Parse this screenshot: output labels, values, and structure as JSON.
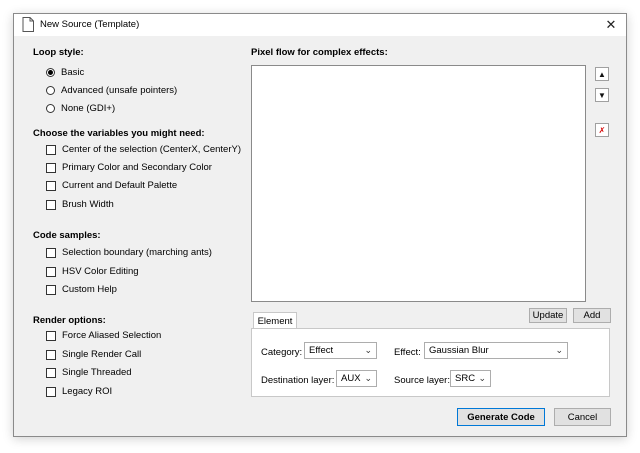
{
  "window": {
    "title": "New Source (Template)",
    "close_glyph": "✕"
  },
  "loop_style": {
    "heading": "Loop style:",
    "options": [
      {
        "label": "Basic",
        "selected": true
      },
      {
        "label": "Advanced (unsafe pointers)",
        "selected": false
      },
      {
        "label": "None (GDI+)",
        "selected": false
      }
    ]
  },
  "variables": {
    "heading": "Choose the variables you might need:",
    "options": [
      {
        "label": "Center of the selection (CenterX, CenterY)",
        "checked": false
      },
      {
        "label": "Primary Color and Secondary Color",
        "checked": false
      },
      {
        "label": "Current and Default Palette",
        "checked": false
      },
      {
        "label": "Brush Width",
        "checked": false
      }
    ]
  },
  "code_samples": {
    "heading": "Code samples:",
    "options": [
      {
        "label": "Selection boundary (marching ants)",
        "checked": false
      },
      {
        "label": "HSV Color Editing",
        "checked": false
      },
      {
        "label": "Custom Help",
        "checked": false
      }
    ]
  },
  "render_options": {
    "heading": "Render options:",
    "options": [
      {
        "label": "Force Aliased Selection",
        "checked": false
      },
      {
        "label": "Single Render Call",
        "checked": false
      },
      {
        "label": "Single Threaded",
        "checked": false
      },
      {
        "label": "Legacy ROI",
        "checked": false
      }
    ]
  },
  "pixel_flow": {
    "heading": "Pixel flow for complex effects:",
    "up_glyph": "▲",
    "down_glyph": "▼",
    "delete_glyph": "✗",
    "delete_color": "#d40000"
  },
  "buttons": {
    "update": "Update",
    "add": "Add",
    "generate": "Generate Code",
    "cancel": "Cancel"
  },
  "element_tab": {
    "tab_label": "Element",
    "category_label": "Category:",
    "category_value": "Effect",
    "effect_label": "Effect:",
    "effect_value": "Gaussian Blur",
    "dest_label": "Destination layer:",
    "dest_value": "AUX",
    "source_label": "Source layer:",
    "source_value": "SRC"
  },
  "colors": {
    "accent": "#0078d7",
    "window_bg": "#f0f0f0"
  }
}
